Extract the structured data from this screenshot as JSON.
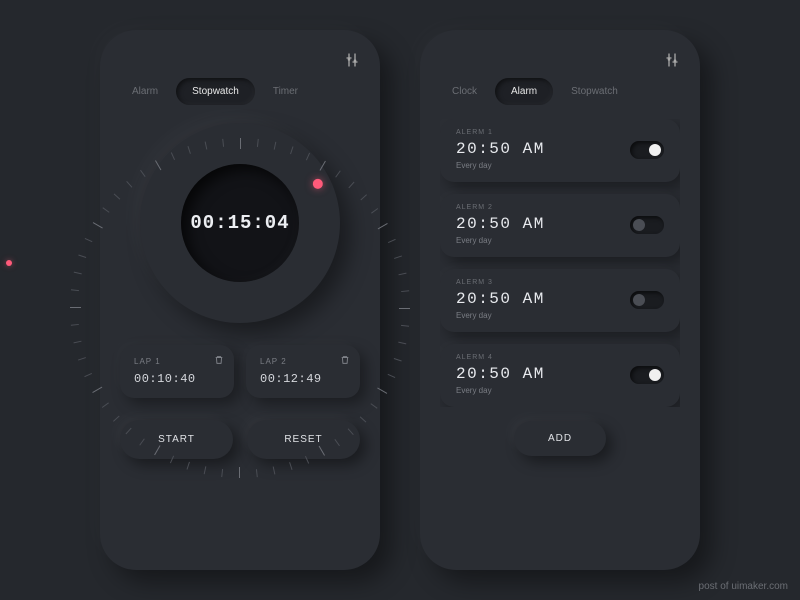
{
  "left": {
    "tabs": [
      {
        "label": "Alarm",
        "active": false
      },
      {
        "label": "Stopwatch",
        "active": true
      },
      {
        "label": "Timer",
        "active": false
      }
    ],
    "time": "00:15:04",
    "laps": [
      {
        "label": "LAP 1",
        "time": "00:10:40"
      },
      {
        "label": "LAP 2",
        "time": "00:12:49"
      }
    ],
    "start_label": "START",
    "reset_label": "RESET"
  },
  "right": {
    "tabs": [
      {
        "label": "Clock",
        "active": false
      },
      {
        "label": "Alarm",
        "active": true
      },
      {
        "label": "Stopwatch",
        "active": false
      }
    ],
    "alarms": [
      {
        "label": "ALERM 1",
        "time": "20:50 AM",
        "repeat": "Every day",
        "on": true
      },
      {
        "label": "ALERM 2",
        "time": "20:50 AM",
        "repeat": "Every day",
        "on": false
      },
      {
        "label": "ALERM 3",
        "time": "20:50 AM",
        "repeat": "Every day",
        "on": false
      },
      {
        "label": "ALERM 4",
        "time": "20:50 AM",
        "repeat": "Every day",
        "on": true
      }
    ],
    "add_label": "ADD"
  },
  "credit": "post of uimaker.com"
}
